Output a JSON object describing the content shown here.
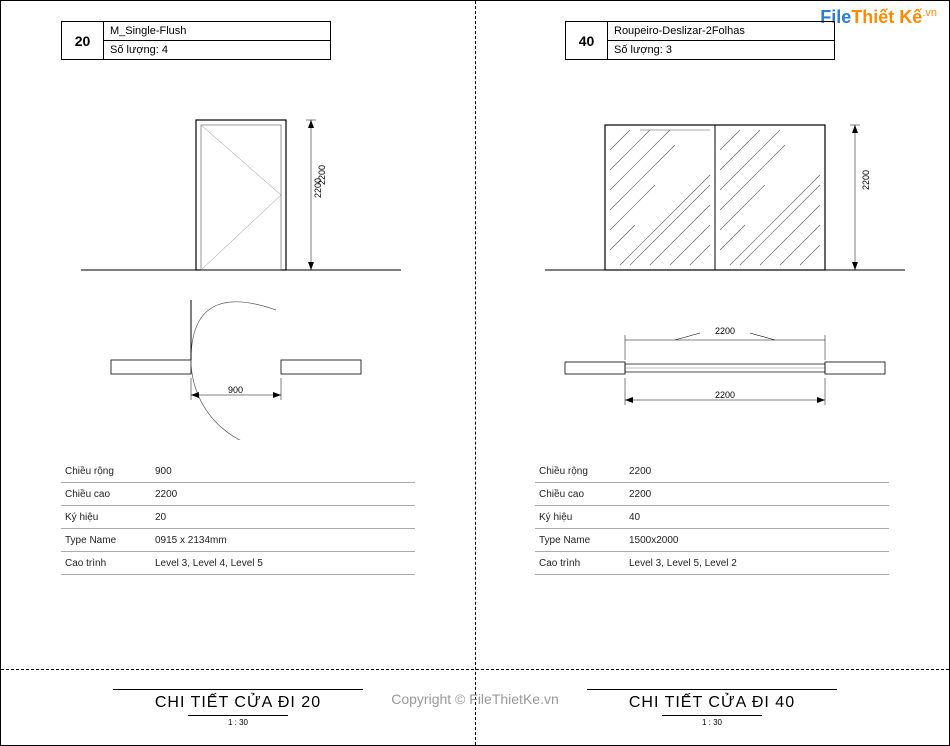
{
  "logo": {
    "part1": "File",
    "part2": "Thiết Kế",
    "suffix": ".vn"
  },
  "copyright": "Copyright © FileThietKe.vn",
  "left": {
    "num": "20",
    "name": "M_Single-Flush",
    "qty_label": "Số lượng:",
    "qty": "4",
    "dim_h": "2200",
    "dim_w": "900",
    "spec": [
      {
        "label": "Chiều rộng",
        "value": "900"
      },
      {
        "label": "Chiều cao",
        "value": "2200"
      },
      {
        "label": "Ký hiệu",
        "value": "20"
      },
      {
        "label": "Type Name",
        "value": "0915 x 2134mm"
      },
      {
        "label": "Cao trình",
        "value": "Level 3, Level 4, Level 5"
      }
    ],
    "footer_title": "CHI TIẾT CỬA ĐI 20",
    "scale": "1 : 30"
  },
  "right": {
    "num": "40",
    "name": "Roupeiro-Deslizar-2Folhas",
    "qty_label": "Số lượng:",
    "qty": "3",
    "dim_h": "2200",
    "dim_w_top": "2200",
    "dim_w_bottom": "2200",
    "spec": [
      {
        "label": "Chiều rộng",
        "value": "2200"
      },
      {
        "label": "Chiều cao",
        "value": "2200"
      },
      {
        "label": "Ký hiệu",
        "value": "40"
      },
      {
        "label": "Type Name",
        "value": "1500x2000"
      },
      {
        "label": "Cao trình",
        "value": "Level 3, Level 5, Level 2"
      }
    ],
    "footer_title": "CHI TIẾT CỬA ĐI 40",
    "scale": "1 : 30"
  },
  "chart_data": [
    {
      "type": "table",
      "title": "CHI TIẾT CỬA ĐI 20",
      "item_number": 20,
      "item_name": "M_Single-Flush",
      "quantity": 4,
      "elevation": {
        "width_mm": 900,
        "height_mm": 2200
      },
      "plan": {
        "opening_mm": 900
      },
      "properties": {
        "Chiều rộng": 900,
        "Chiều cao": 2200,
        "Ký hiệu": 20,
        "Type Name": "0915 x 2134mm",
        "Cao trình": [
          "Level 3",
          "Level 4",
          "Level 5"
        ]
      },
      "scale": "1 : 30"
    },
    {
      "type": "table",
      "title": "CHI TIẾT CỬA ĐI 40",
      "item_number": 40,
      "item_name": "Roupeiro-Deslizar-2Folhas",
      "quantity": 3,
      "elevation": {
        "width_mm": 2200,
        "height_mm": 2200
      },
      "plan": {
        "opening_mm": 2200
      },
      "properties": {
        "Chiều rộng": 2200,
        "Chiều cao": 2200,
        "Ký hiệu": 40,
        "Type Name": "1500x2000",
        "Cao trình": [
          "Level 3",
          "Level 5",
          "Level 2"
        ]
      },
      "scale": "1 : 30"
    }
  ]
}
